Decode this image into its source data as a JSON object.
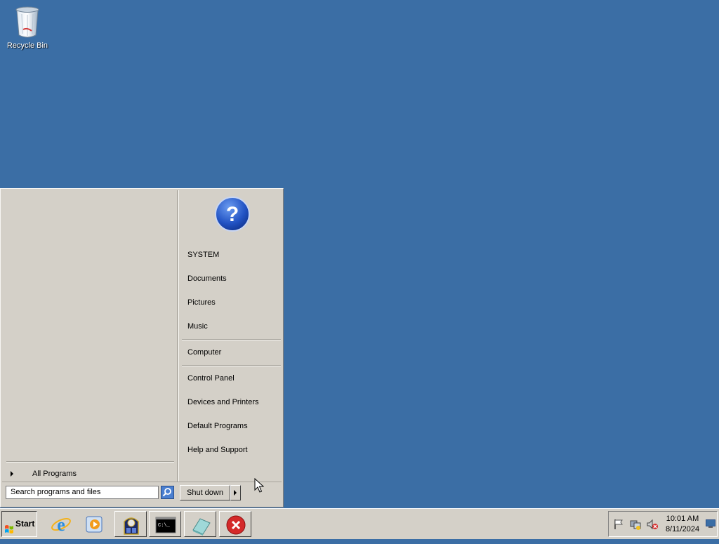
{
  "desktop": {
    "icons": [
      {
        "label": "Recycle Bin",
        "icon": "recycle-bin-icon"
      }
    ]
  },
  "start_menu": {
    "user_picture": "help-question-icon",
    "right_items": [
      {
        "label": "SYSTEM"
      },
      {
        "label": "Documents"
      },
      {
        "label": "Pictures"
      },
      {
        "label": "Music"
      },
      {
        "label": "Computer"
      },
      {
        "label": "Control Panel"
      },
      {
        "label": "Devices and Printers"
      },
      {
        "label": "Default Programs"
      },
      {
        "label": "Help and Support"
      }
    ],
    "all_programs_label": "All Programs",
    "search_placeholder": "Search programs and files",
    "shutdown_label": "Shut down"
  },
  "taskbar": {
    "start_label": "Start",
    "pinned": [
      {
        "name": "internet-explorer-icon"
      },
      {
        "name": "media-player-icon"
      },
      {
        "name": "scheduler-icon"
      },
      {
        "name": "command-prompt-icon"
      },
      {
        "name": "eraser-icon"
      },
      {
        "name": "close-error-icon"
      }
    ],
    "tray": {
      "icons": [
        "action-center-flag-icon",
        "network-icon",
        "volume-muted-icon"
      ],
      "time": "10:01 AM",
      "date": "8/11/2024"
    }
  },
  "colors": {
    "desktop": "#3b6ea5",
    "chrome": "#d4d0c8"
  }
}
